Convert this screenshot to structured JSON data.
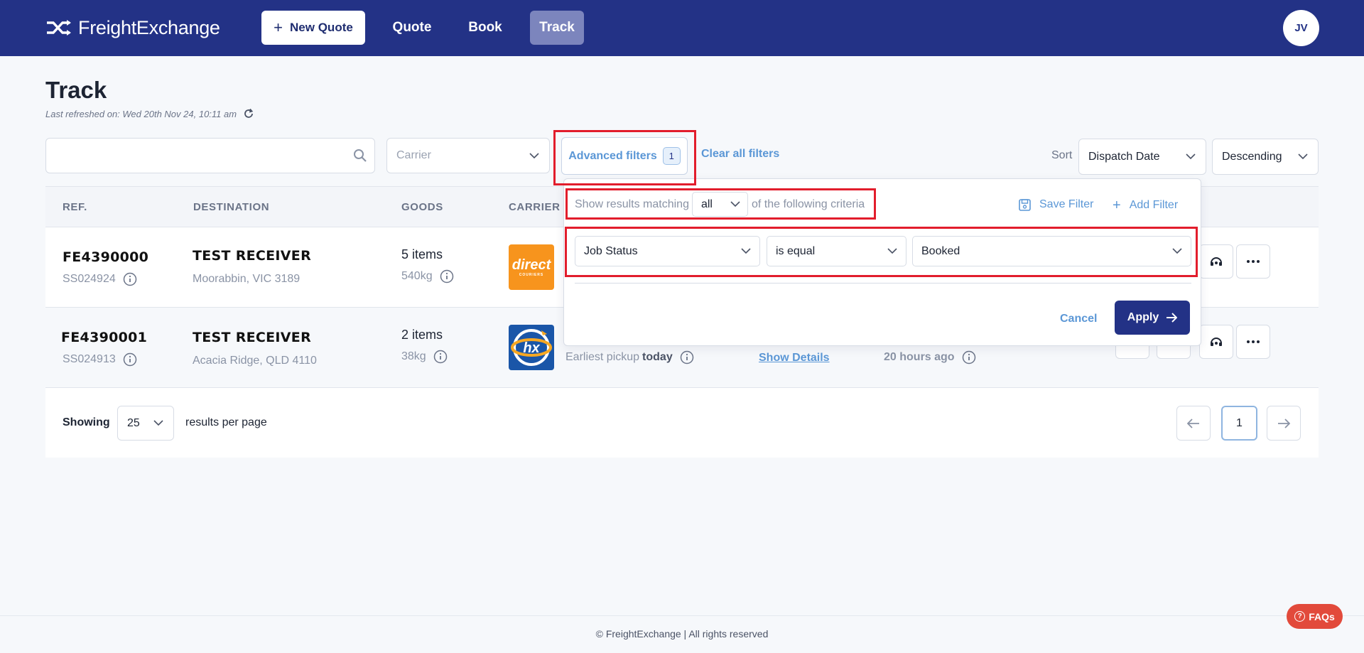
{
  "app": {
    "brand": "FreightExchange",
    "user_initials": "JV"
  },
  "nav": {
    "new_quote": "New Quote",
    "quote": "Quote",
    "book": "Book",
    "track": "Track"
  },
  "page": {
    "title": "Track",
    "last_refreshed": "Last refreshed on: Wed 20th Nov 24, 10:11 am"
  },
  "filters": {
    "search_value": "",
    "carrier_placeholder": "Carrier",
    "advanced_label": "Advanced filters",
    "advanced_count": "1",
    "clear_all": "Clear all filters",
    "sort_label": "Sort",
    "sort_value": "Dispatch Date",
    "order_value": "Descending"
  },
  "advanced_popover": {
    "prefix": "Show results matching",
    "match_value": "all",
    "suffix": "of the following criteria",
    "save_filter": "Save Filter",
    "add_filter": "Add Filter",
    "rule": {
      "field": "Job Status",
      "operator": "is equal",
      "value": "Booked"
    },
    "cancel": "Cancel",
    "apply": "Apply"
  },
  "table": {
    "columns": [
      "REF.",
      "DESTINATION",
      "GOODS",
      "CARRIER"
    ],
    "rows": [
      {
        "ref": "FE4390000",
        "sub_ref": "SS024924",
        "destination": "TEST RECEIVER",
        "suburb": "Moorabbin, VIC 3189",
        "items": "5 items",
        "weight": "540kg",
        "carrier_logo": "direct-couriers"
      },
      {
        "ref": "FE4390001",
        "sub_ref": "SS024913",
        "destination": "TEST RECEIVER",
        "suburb": "Acacia Ridge, QLD 4110",
        "items": "2 items",
        "weight": "38kg",
        "carrier_logo": "hx",
        "pickup_label": "Earliest pickup",
        "pickup_value": "today",
        "details_link": "Show Details",
        "updated": "20 hours ago"
      }
    ]
  },
  "pagination": {
    "showing": "Showing",
    "per_page": "25",
    "per_page_text": "results per page",
    "current_page": "1"
  },
  "footer": {
    "copyright": "© FreightExchange | All rights reserved",
    "faqs": "FAQs"
  },
  "colors": {
    "brand_navy": "#233286",
    "active_nav": "#7c85bd",
    "link_blue": "#5b97d6",
    "highlight_red": "#e21d2c",
    "faq_red": "#e24a3b"
  },
  "carrier_logos": {
    "direct": "direct",
    "direct_small": "COURIERS",
    "hx": "hx"
  }
}
